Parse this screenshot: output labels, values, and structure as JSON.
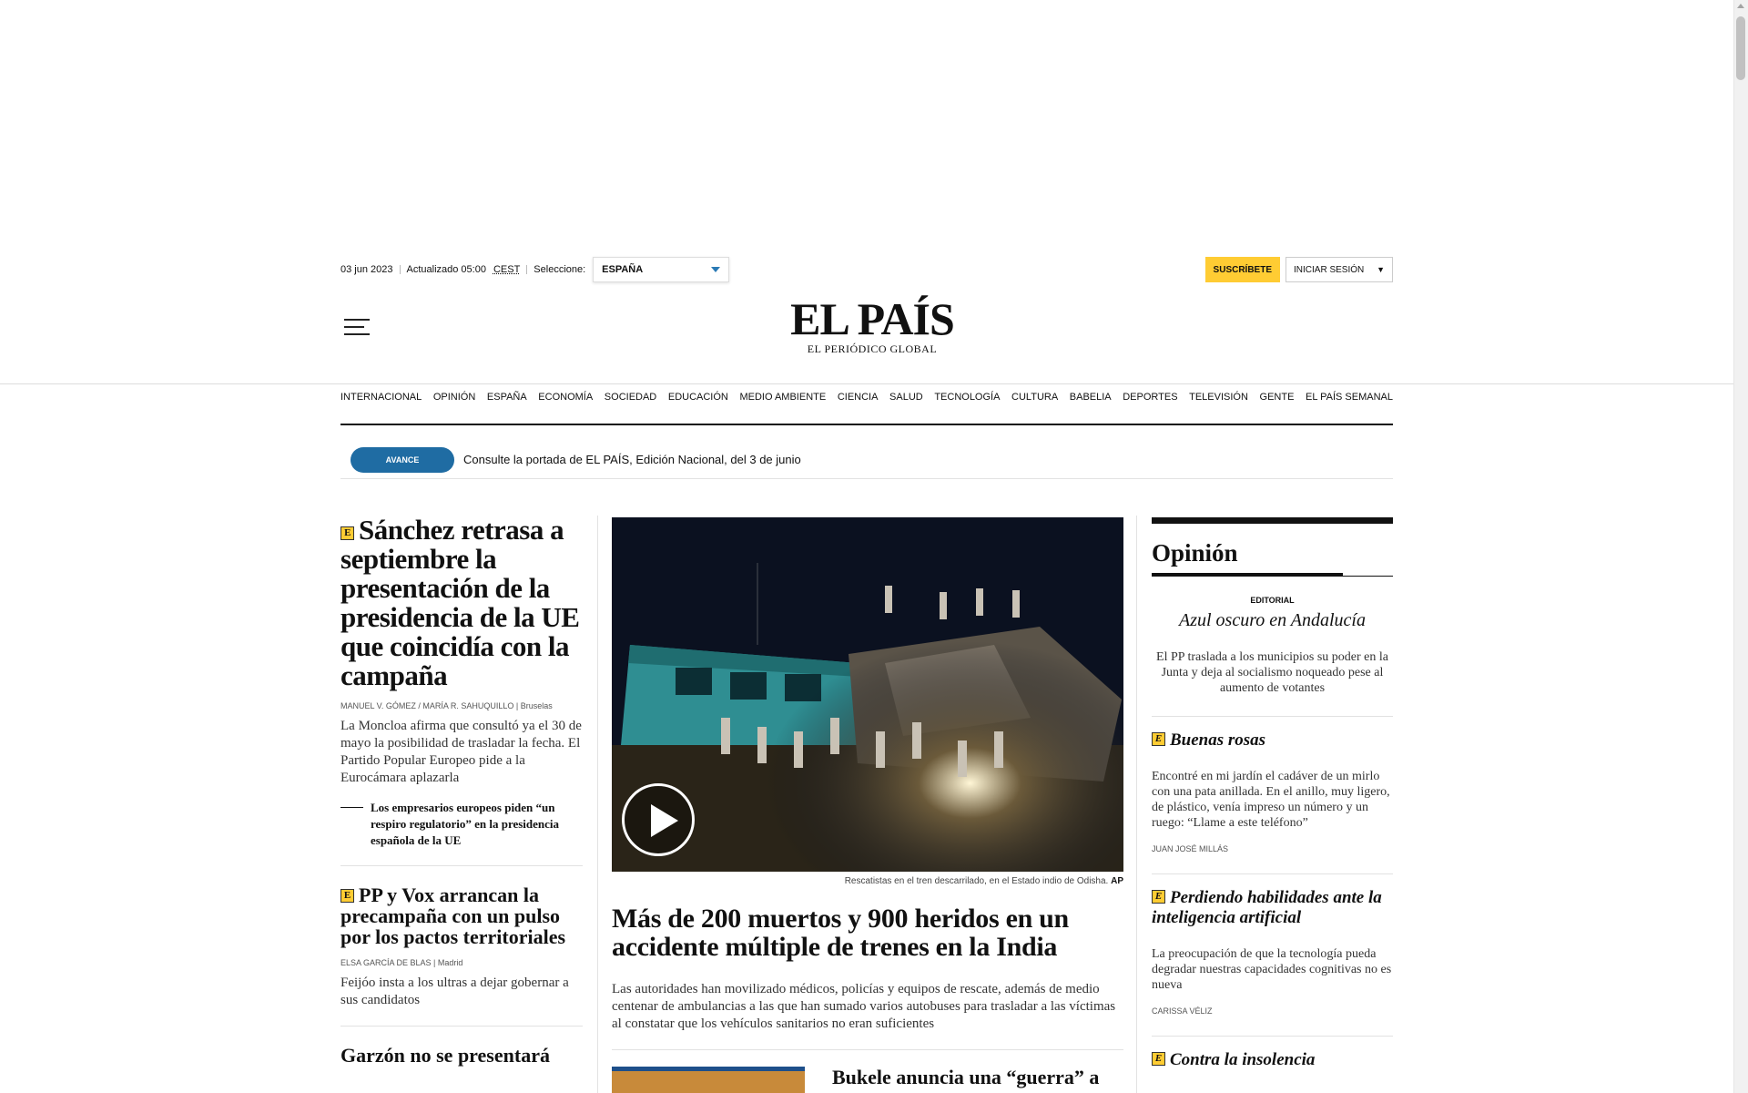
{
  "header": {
    "date": "03 jun 2023",
    "updated": "Actualizado 05:00",
    "timezone": "CEST",
    "select_label": "Seleccione:",
    "edition": "ESPAÑA",
    "subscribe": "SUSCRÍBETE",
    "login": "INICIAR SESIÓN"
  },
  "logo": {
    "name": "EL PAÍS",
    "tagline": "EL PERIÓDICO GLOBAL"
  },
  "nav": [
    "INTERNACIONAL",
    "OPINIÓN",
    "ESPAÑA",
    "ECONOMÍA",
    "SOCIEDAD",
    "EDUCACIÓN",
    "MEDIO AMBIENTE",
    "CIENCIA",
    "SALUD",
    "TECNOLOGÍA",
    "CULTURA",
    "BABELIA",
    "DEPORTES",
    "TELEVISIÓN",
    "GENTE",
    "EL PAÍS SEMANAL"
  ],
  "ticker": {
    "badge": "AVANCE",
    "text": "Consulte la portada de EL PAÍS, Edición Nacional, del 3 de junio"
  },
  "left": {
    "story1": {
      "badge": "E",
      "headline": "Sánchez retrasa a septiembre la presentación de la presidencia de la UE que coincidía con la campaña",
      "byline": "MANUEL V. GÓMEZ / MARÍA R. SAHUQUILLO | Bruselas",
      "summary": "La Moncloa afirma que consultó ya el 30 de mayo la posibilidad de trasladar la fecha. El Partido Popular Europeo pide a la Eurocámara aplazarla",
      "related": "Los empresarios europeos piden “un respiro regulatorio” en la presidencia española de la UE"
    },
    "story2": {
      "badge": "E",
      "headline": "PP y Vox arrancan la precampaña con un pulso por los pactos territoriales",
      "byline": "ELSA GARCÍA DE BLAS | Madrid",
      "summary": "Feijóo insta a los ultras a dejar gobernar a sus candidatos"
    },
    "story3": {
      "headline": "Garzón no se presentará"
    }
  },
  "center": {
    "caption": "Rescatistas en el tren descarrilado, en el Estado indio de Odisha.",
    "credit": "AP",
    "headline": "Más de 200 muertos y 900 heridos en un accidente múltiple de trenes en la India",
    "summary": "Las autoridades han movilizado médicos, policías y equipos de rescate, además de medio centenar de ambulancias a las que han sumado varios autobuses para trasladar a las víctimas al constatar que los vehículos sanitarios no eran suficientes",
    "next_headline": "Bukele anuncia una “guerra” a"
  },
  "opinion": {
    "title": "Opinión",
    "editorial_label": "EDITORIAL",
    "editorial_title": "Azul oscuro en Andalucía",
    "editorial_summary": "El PP traslada a los municipios su poder en la Junta y deja al socialismo noqueado pese al aumento de votantes",
    "items": [
      {
        "badge": "E",
        "title": "Buenas rosas",
        "summary": "Encontré en mi jardín el cadáver de un mirlo con una pata anillada. En el anillo, muy ligero, de plástico, venía impreso un número y un ruego: “Llame a este teléfono”",
        "author": "JUAN JOSÉ MILLÁS"
      },
      {
        "badge": "E",
        "title": "Perdiendo habilidades ante la inteligencia artificial",
        "summary": "La preocupación de que la tecnología pueda degradar nuestras capacidades cognitivas no es nueva",
        "author": "CARISSA VÉLIZ"
      },
      {
        "badge": "E",
        "title": "Contra la insolencia"
      }
    ]
  },
  "colors": {
    "accent_yellow": "#ffcc33",
    "avance_blue": "#1f6ca3"
  }
}
